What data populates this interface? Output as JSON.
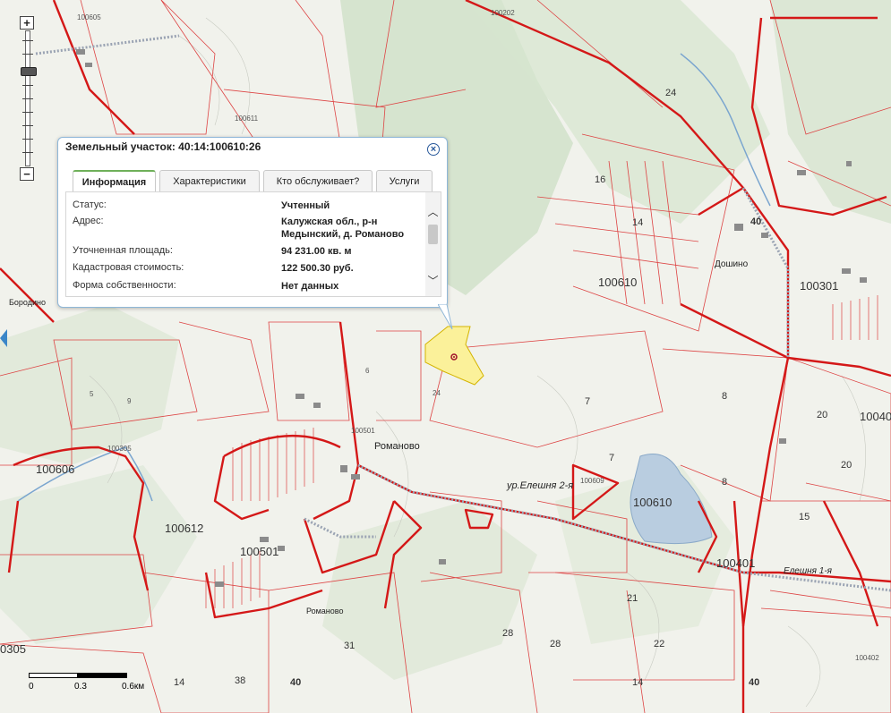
{
  "popup": {
    "title": "Земельный участок: 40:14:100610:26",
    "tabs": [
      {
        "label": "Информация",
        "active": true
      },
      {
        "label": "Характеристики",
        "active": false
      },
      {
        "label": "Кто обслуживает?",
        "active": false
      },
      {
        "label": "Услуги",
        "active": false
      }
    ],
    "rows": [
      {
        "label": "Статус:",
        "value": "Учтенный"
      },
      {
        "label": "Адрес:",
        "value": "Калужская обл., р-н Медынский, д. Романово"
      },
      {
        "label": "Уточненная площадь:",
        "value": "94 231.00 кв. м"
      },
      {
        "label": "Кадастровая стоимость:",
        "value": "122 500.30 руб."
      },
      {
        "label": "Форма собственности:",
        "value": "Нет данных"
      }
    ],
    "close_icon": "close-icon"
  },
  "map": {
    "place_labels": {
      "romanovo": "Романово",
      "romanovo_south": "Романово",
      "doshino": "Дошино",
      "borodino": "Бородино",
      "elesha2": "ур.Елешня 2-я",
      "elesha1": "Елешня 1-я"
    },
    "cadastral_labels": {
      "q100610_a": "100610",
      "q100610_b": "100610",
      "q100301": "100301",
      "q100401": "100401",
      "q100501": "100501",
      "q100612": "100612",
      "q100606": "100606",
      "q10040": "10040",
      "q0305": "0305",
      "q100605": "100605",
      "q100611": "100611",
      "q100202": "100202",
      "q100402": "100402",
      "q100501s": "100501",
      "q100609": "100609",
      "q100305": "100305"
    },
    "parcel_numbers": {
      "n24a": "24",
      "n16": "16",
      "n14a": "14",
      "n40a": "40",
      "n40b": "40",
      "n40c": "40",
      "n8": "8",
      "n20a": "20",
      "n20b": "20",
      "n15": "15",
      "n7a": "7",
      "n7b": "7",
      "n24b": "24",
      "n21": "21",
      "n22": "22",
      "n28a": "28",
      "n28b": "28",
      "n31": "31",
      "n38": "38",
      "n14b": "14",
      "n14c": "14",
      "n6": "6",
      "n5": "5",
      "n8b": "8",
      "n9": "9"
    }
  },
  "scale": {
    "label_0": "0",
    "label_mid": "0.3",
    "label_end": "0.6км"
  },
  "zoom": {
    "plus": "+",
    "minus": "−"
  }
}
